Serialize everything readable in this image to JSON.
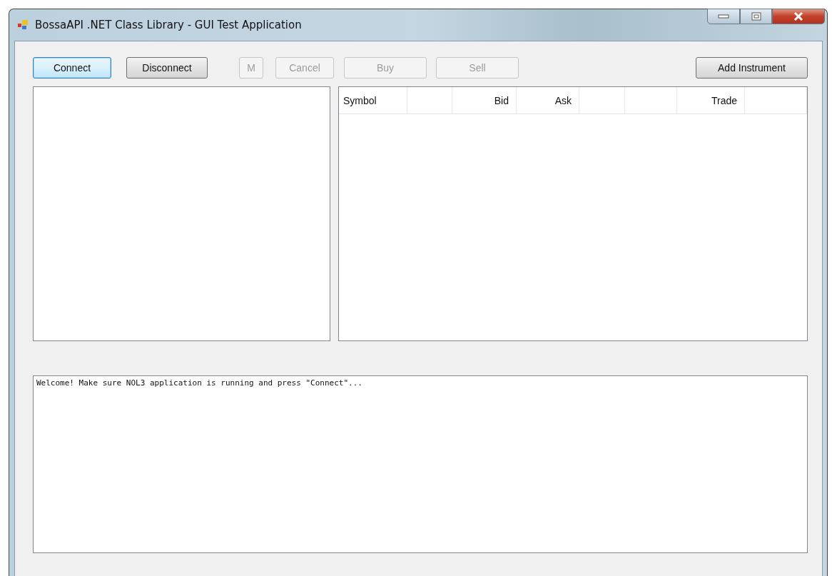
{
  "window": {
    "title": "BossaAPI .NET Class Library - GUI Test Application"
  },
  "toolbar": [
    {
      "label": "Connect",
      "disabled": false,
      "focused": true
    },
    {
      "label": "Disconnect",
      "disabled": false,
      "focused": false
    },
    {
      "label": "M",
      "disabled": true,
      "focused": false
    },
    {
      "label": "Cancel",
      "disabled": true,
      "focused": false
    },
    {
      "label": "Buy",
      "disabled": true,
      "focused": false
    },
    {
      "label": "Sell",
      "disabled": true,
      "focused": false
    },
    {
      "label": "Add Instrument",
      "disabled": false,
      "focused": false
    }
  ],
  "table": {
    "columns": [
      {
        "label": "Symbol"
      },
      {},
      {
        "label": "Bid"
      },
      {
        "label": "Ask"
      },
      {},
      {},
      {
        "label": "Trade"
      },
      {}
    ]
  },
  "log": {
    "lines": [
      "Welcome! Make sure NOL3 application is running and press \"Connect\"..."
    ]
  }
}
